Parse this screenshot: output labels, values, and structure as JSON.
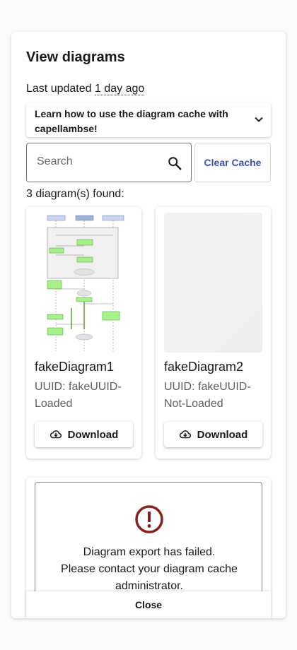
{
  "dialog": {
    "title": "View diagrams",
    "updated_prefix": "Last updated",
    "updated_value": "1 day ago"
  },
  "learn": {
    "text": "Learn how to use the diagram cache with capellambse!",
    "icon": "chevron-down-icon"
  },
  "search": {
    "placeholder": "Search",
    "value": "",
    "icon": "search-icon"
  },
  "clear_label": "Clear Cache",
  "found_text": "3 diagram(s) found:",
  "diagrams": [
    {
      "name": "fakeDiagram1",
      "uuid": "UUID: fakeUUID-Loaded",
      "download": "Download",
      "thumbnail": "sequence-diagram-preview"
    },
    {
      "name": "fakeDiagram2",
      "uuid": "UUID: fakeUUID-Not-Loaded",
      "download": "Download",
      "thumbnail": "placeholder"
    }
  ],
  "error": {
    "icon": "error-icon",
    "line1": "Diagram export has failed.",
    "line2": "Please contact your diagram cache",
    "line3": "administrator."
  },
  "close_label": "Close",
  "colors": {
    "accent": "#3f51b5",
    "error": "#8b1f1f",
    "preview_green": "#a8f08a"
  }
}
